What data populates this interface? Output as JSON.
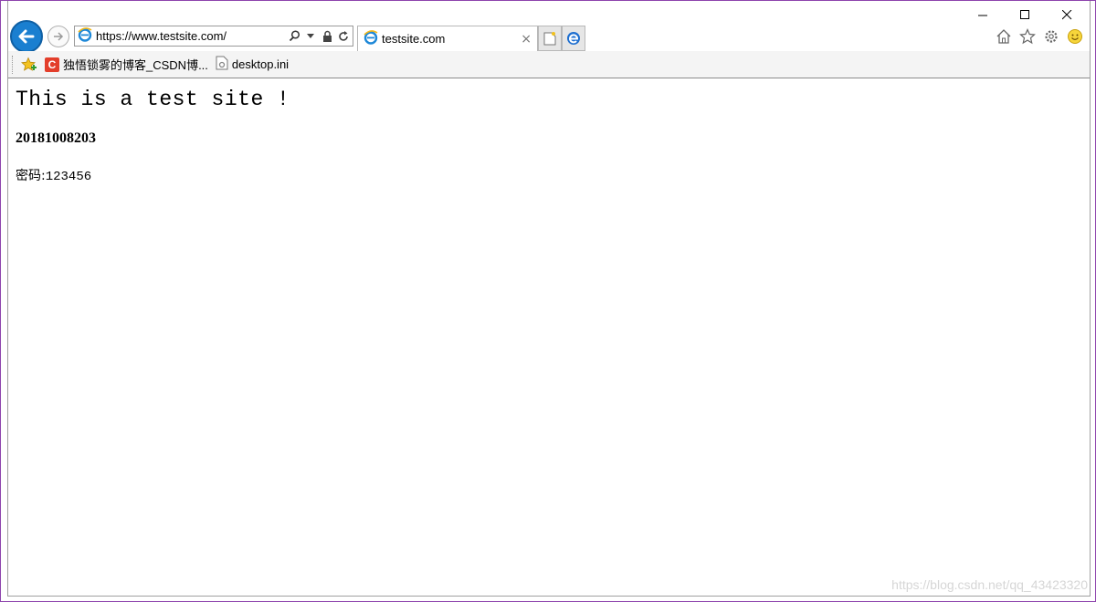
{
  "browser": {
    "address_url": "https://www.testsite.com/",
    "tab_title": "testsite.com",
    "tab_close_glyph": "×"
  },
  "icons": {
    "back": "back-arrow-icon",
    "forward": "forward-arrow-icon",
    "site": "ie-icon",
    "search": "search-icon",
    "dropdown": "chevron-down-icon",
    "lock": "lock-icon",
    "refresh": "refresh-icon",
    "new_tab": "new-tab-icon",
    "edge": "edge-icon",
    "home": "home-icon",
    "favorites": "star-icon",
    "settings": "gear-icon",
    "feedback": "smiley-icon"
  },
  "favorites_bar": {
    "items": [
      {
        "label": "独悟锁雾的博客_CSDN博...",
        "icon": "csdn-icon",
        "icon_letter": "C"
      },
      {
        "label": "desktop.ini",
        "icon": "document-icon"
      }
    ]
  },
  "page": {
    "heading": "This is a test site !",
    "subheading": "20181008203",
    "password_label": "密码:",
    "password_value": "123456"
  },
  "watermark": "https://blog.csdn.net/qq_43423320",
  "colors": {
    "accent_blue": "#1a7fd0",
    "window_border": "#8e44ad",
    "csdn_red": "#e33e2b"
  }
}
